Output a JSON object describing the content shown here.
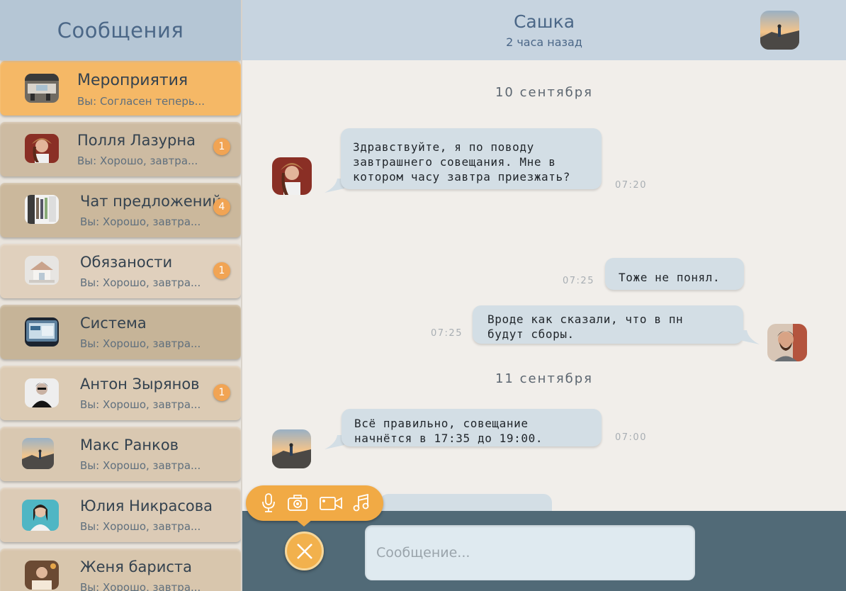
{
  "sidebar": {
    "title": "Сообщения",
    "chats": [
      {
        "name": "Мероприятия",
        "preview": "Вы: Согласен теперь...",
        "badge": "",
        "bg": "#f5b866",
        "active": true
      },
      {
        "name": "Полля Лазурна",
        "preview": "Вы: Хорошо, завтра...",
        "badge": "1",
        "bg": "#cdbba2"
      },
      {
        "name": "Чат предложений",
        "preview": "Вы: Хорошо, завтра...",
        "badge": "4",
        "bg": "#cbb89c"
      },
      {
        "name": "Обязаности",
        "preview": "Вы: Хорошо, завтра...",
        "badge": "1",
        "bg": "#e0d0bd"
      },
      {
        "name": "Система",
        "preview": "Вы: Хорошо, завтра...",
        "badge": "",
        "bg": "#c6b498"
      },
      {
        "name": "Антон Зырянов",
        "preview": "Вы: Хорошо, завтра...",
        "badge": "1",
        "bg": "#dccbb4"
      },
      {
        "name": "Макс Ранков",
        "preview": "Вы: Хорошо, завтра...",
        "badge": "",
        "bg": "#d9c8b1"
      },
      {
        "name": "Юлия Никрасова",
        "preview": "Вы: Хорошо, завтра...",
        "badge": "",
        "bg": "#dccbb6"
      },
      {
        "name": "Женя бариста",
        "preview": "Вы: Хорошо, завтра...",
        "badge": "",
        "bg": "#d8c6ad"
      }
    ]
  },
  "header": {
    "title": "Сашка",
    "status": "2 часа назад"
  },
  "conversation": {
    "dates": [
      "10 сентября",
      "11 сентября"
    ],
    "messages": [
      {
        "text": "Здравствуйте, я по поводу\nзавтрашнего совещания. Мне в\nкотором часу завтра приезжать?",
        "time": "07:20"
      },
      {
        "text": "Тоже не понял.",
        "time": "07:25"
      },
      {
        "text": "Вроде как сказали, что в пн\nбудут сборы.",
        "time": "07:25"
      },
      {
        "text": "Всё правильно, совещание\nначнётся в 17:35 до 19:00.",
        "time": "07:00"
      }
    ]
  },
  "composer": {
    "placeholder": "Сообщение..."
  },
  "colors": {
    "accent": "#f1aa45",
    "bubble": "#d3dee5",
    "header": "#c7d4e0",
    "composer": "#516a77"
  },
  "icons": [
    "microphone-icon",
    "camera-icon",
    "video-camera-icon",
    "music-note-icon",
    "close-icon"
  ]
}
